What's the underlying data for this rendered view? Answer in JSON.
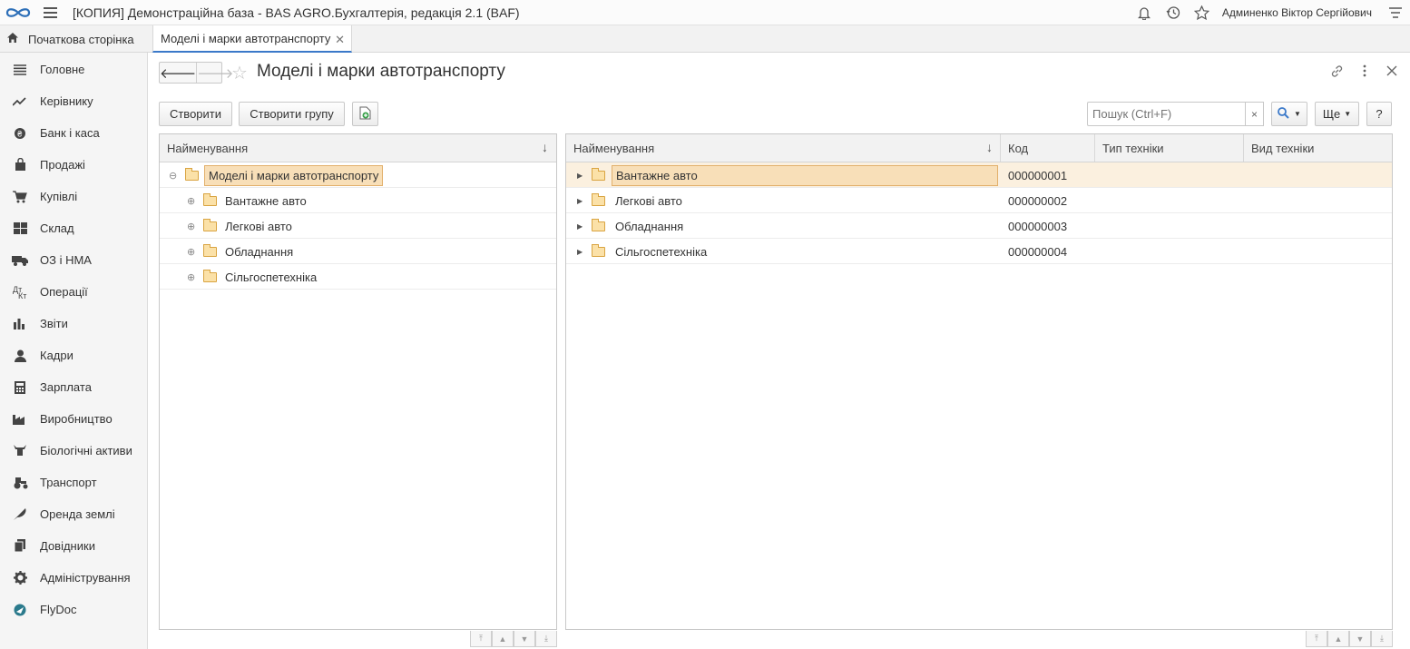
{
  "topbar": {
    "title": "[КОПИЯ] Демонстраційна база - BAS AGRO.Бухгалтерія, редакція 2.1  (BAF)",
    "user": "Админенко Віктор Сергійович"
  },
  "tabs": {
    "home": "Початкова сторінка",
    "active": "Моделі і марки автотранспорту"
  },
  "sidebar": {
    "items": [
      {
        "label": "Головне",
        "icon": "list-icon"
      },
      {
        "label": "Керівнику",
        "icon": "trend-icon"
      },
      {
        "label": "Банк і каса",
        "icon": "coin-icon"
      },
      {
        "label": "Продажі",
        "icon": "bag-icon"
      },
      {
        "label": "Купівлі",
        "icon": "cart-icon"
      },
      {
        "label": "Склад",
        "icon": "warehouse-icon"
      },
      {
        "label": "ОЗ і НМА",
        "icon": "truck-icon"
      },
      {
        "label": "Операції",
        "icon": "operations-icon"
      },
      {
        "label": "Звіти",
        "icon": "bar-chart-icon"
      },
      {
        "label": "Кадри",
        "icon": "person-icon"
      },
      {
        "label": "Зарплата",
        "icon": "calculator-icon"
      },
      {
        "label": "Виробництво",
        "icon": "factory-icon"
      },
      {
        "label": "Біологічні активи",
        "icon": "cow-icon"
      },
      {
        "label": "Транспорт",
        "icon": "tractor-icon"
      },
      {
        "label": "Оренда землі",
        "icon": "feather-icon"
      },
      {
        "label": "Довідники",
        "icon": "books-icon"
      },
      {
        "label": "Адміністрування",
        "icon": "gear-icon"
      },
      {
        "label": "FlyDoc",
        "icon": "flydoc-icon"
      }
    ]
  },
  "form": {
    "title": "Моделі і марки автотранспорту",
    "create_label": "Створити",
    "create_group_label": "Створити групу",
    "search_placeholder": "Пошук (Ctrl+F)",
    "search_clear": "×",
    "more_label": "Ще",
    "help_label": "?"
  },
  "tree": {
    "header": "Найменування",
    "root": "Моделі і марки автотранспорту",
    "children": [
      "Вантажне авто",
      "Легкові авто",
      "Обладнання",
      "Сільгоспетехніка"
    ]
  },
  "list": {
    "columns": [
      "Найменування",
      "Код",
      "Тип техніки",
      "Вид техніки"
    ],
    "rows": [
      {
        "name": "Вантажне авто",
        "code": "000000001",
        "type": "",
        "kind": ""
      },
      {
        "name": "Легкові авто",
        "code": "000000002",
        "type": "",
        "kind": ""
      },
      {
        "name": "Обладнання",
        "code": "000000003",
        "type": "",
        "kind": ""
      },
      {
        "name": "Сільгоспетехніка",
        "code": "000000004",
        "type": "",
        "kind": ""
      }
    ]
  },
  "colors": {
    "accent": "#3b79c9",
    "selection": "#fbf0df",
    "folder": "#fbe1a8"
  }
}
